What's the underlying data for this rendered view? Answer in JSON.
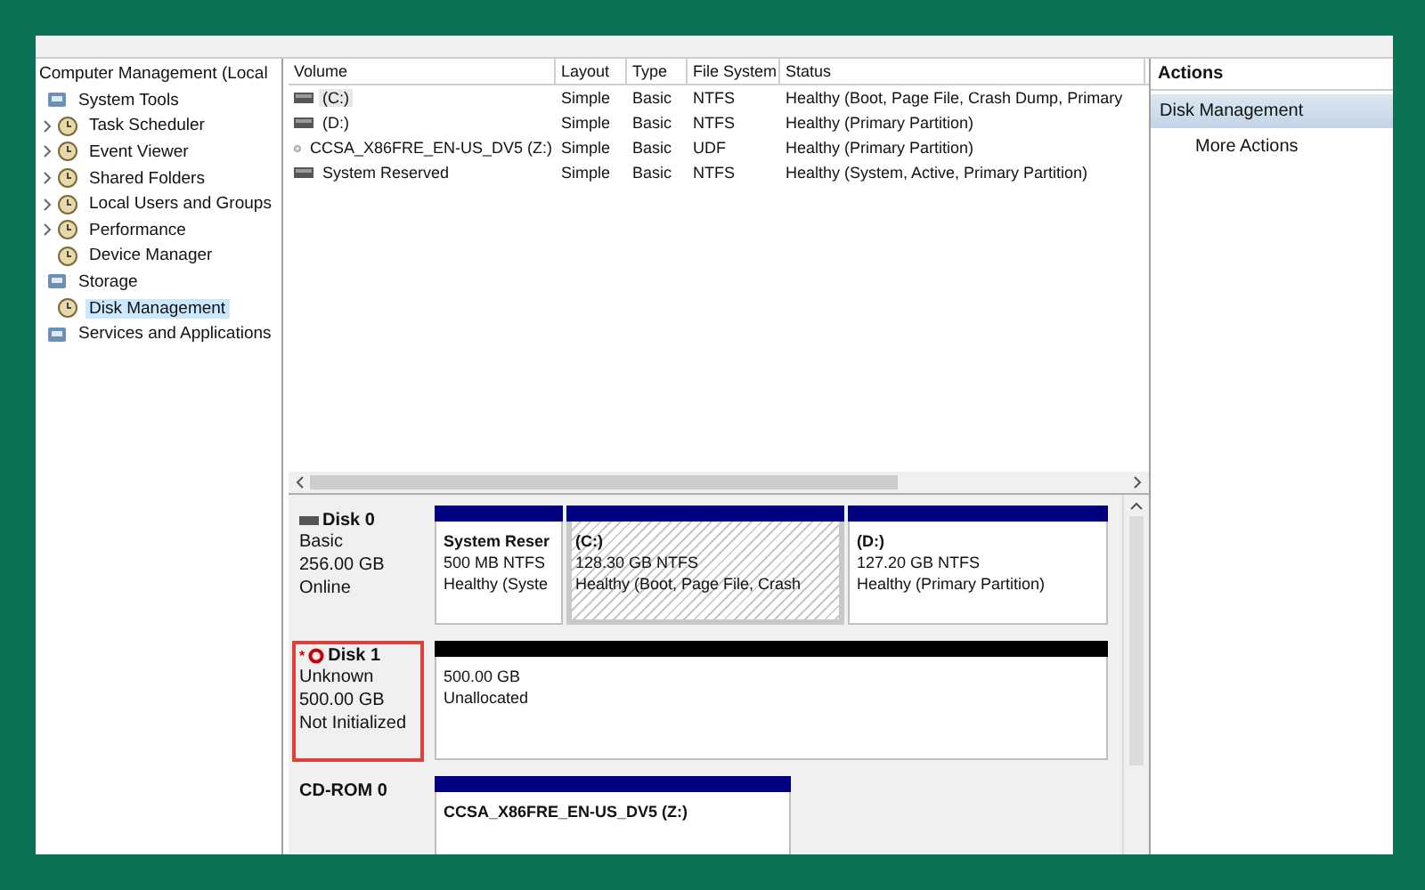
{
  "tree": {
    "label": "Computer Management (Local",
    "children": [
      {
        "label": "System Tools",
        "collapsed": false,
        "selected": false,
        "children": [
          {
            "label": "Task Scheduler",
            "collapsed": true,
            "selected": false
          },
          {
            "label": "Event Viewer",
            "collapsed": true,
            "selected": false
          },
          {
            "label": "Shared Folders",
            "collapsed": true,
            "selected": false
          },
          {
            "label": "Local Users and Groups",
            "collapsed": true,
            "selected": false
          },
          {
            "label": "Performance",
            "collapsed": true,
            "selected": false
          },
          {
            "label": "Device Manager",
            "collapsed": false,
            "selected": false
          }
        ]
      },
      {
        "label": "Storage",
        "collapsed": false,
        "selected": false,
        "children": [
          {
            "label": "Disk Management",
            "collapsed": false,
            "selected": true
          }
        ]
      },
      {
        "label": "Services and Applications",
        "collapsed": false,
        "selected": false
      }
    ]
  },
  "volumes": {
    "columns": [
      "Volume",
      "Layout",
      "Type",
      "File System",
      "Status"
    ],
    "rows": [
      {
        "kind": "disk",
        "selected": true,
        "cells": [
          "(C:)",
          "Simple",
          "Basic",
          "NTFS",
          "Healthy (Boot, Page File, Crash Dump, Primary"
        ]
      },
      {
        "kind": "disk",
        "selected": false,
        "cells": [
          "(D:)",
          "Simple",
          "Basic",
          "NTFS",
          "Healthy (Primary Partition)"
        ]
      },
      {
        "kind": "cdrom",
        "selected": false,
        "cells": [
          "CCSA_X86FRE_EN-US_DV5 (Z:)",
          "Simple",
          "Basic",
          "UDF",
          "Healthy (Primary Partition)"
        ]
      },
      {
        "kind": "disk",
        "selected": false,
        "cells": [
          "System Reserved",
          "Simple",
          "Basic",
          "NTFS",
          "Healthy (System, Active, Primary Partition)"
        ]
      }
    ]
  },
  "disks": [
    {
      "kind": "disk",
      "name": "Disk 0",
      "highlighted": false,
      "lines": [
        "Basic",
        "256.00 GB",
        "Online"
      ],
      "partitions": [
        {
          "label": "System Reser",
          "size": "500 MB NTFS",
          "status": "Healthy (Syste",
          "color": "#000080",
          "selected": false
        },
        {
          "label": "(C:)",
          "size": "128.30 GB NTFS",
          "status": "Healthy (Boot, Page File, Crash",
          "color": "#000080",
          "selected": true
        },
        {
          "label": "(D:)",
          "size": "127.20 GB NTFS",
          "status": "Healthy (Primary Partition)",
          "color": "#000080",
          "selected": false
        }
      ]
    },
    {
      "kind": "uninitialized",
      "marker": "*",
      "name": "Disk 1",
      "highlighted": true,
      "lines": [
        "Unknown",
        "500.00 GB",
        "Not Initialized"
      ],
      "partitions": [
        {
          "size": "500.00 GB",
          "status": "Unallocated",
          "color": "#000000",
          "selected": false
        }
      ]
    },
    {
      "kind": "cdrom",
      "name": "CD-ROM 0",
      "highlighted": false,
      "partitions": [
        {
          "label": "CCSA_X86FRE_EN-US_DV5  (Z:)",
          "color": "#000080",
          "selected": false
        }
      ]
    }
  ],
  "actions": {
    "title": "Actions",
    "items": [
      {
        "kind": "header",
        "label": "Disk Management"
      },
      {
        "kind": "action",
        "label": "More Actions"
      }
    ]
  }
}
